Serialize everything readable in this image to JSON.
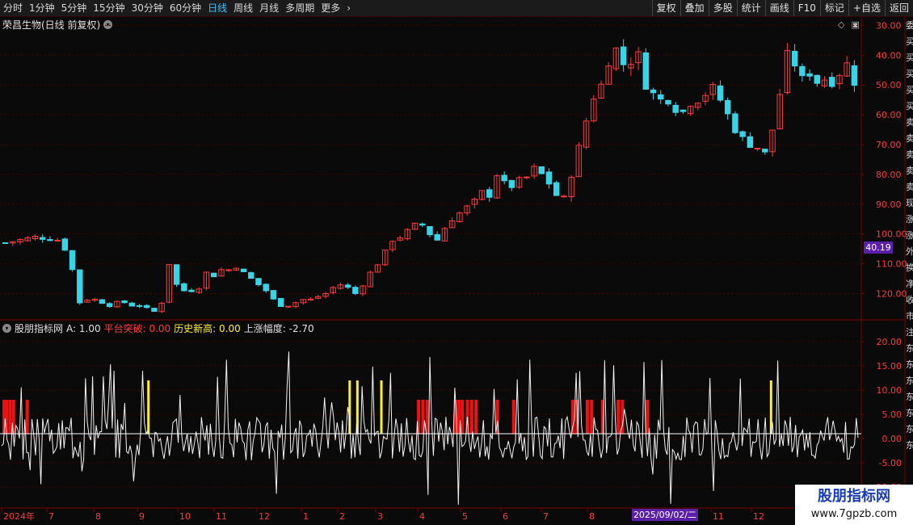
{
  "toolbar": {
    "periods": [
      "分时",
      "1分钟",
      "5分钟",
      "15分钟",
      "30分钟",
      "60分钟",
      "日线",
      "周线",
      "月线",
      "多周期",
      "更多"
    ],
    "active_period": "日线",
    "more_icon": "chevron-right-icon",
    "right_buttons": [
      "复权",
      "叠加",
      "多股",
      "统计",
      "画线",
      "F10",
      "标记",
      "+自选",
      "返回"
    ]
  },
  "stock": {
    "title": "荣昌生物(日线 前复权)",
    "menu_icon": "chevron-down-icon"
  },
  "top_icons": [
    "diamond-icon",
    "window-icon"
  ],
  "price_axis": {
    "ticks": [
      "120.00",
      "110.00",
      "100.00",
      "90.00",
      "80.00",
      "70.00",
      "60.00",
      "50.00",
      "40.00",
      "30.00"
    ],
    "current_price": "40.19"
  },
  "indicator": {
    "name": "股朋指标网",
    "series": [
      {
        "label": "A: 1.00",
        "color": "#e0e0e0"
      },
      {
        "label": "平台突破: 0.00",
        "color": "#ff3b3b"
      },
      {
        "label": "历史新高: 0.00",
        "color": "#ffee33"
      },
      {
        "label": "上涨幅度: -2.70",
        "color": "#e0e0e0"
      }
    ],
    "axis_ticks": [
      "20.00",
      "15.00",
      "10.00",
      "5.00",
      "0.00",
      "-5.00",
      "-10.00"
    ]
  },
  "date_axis": {
    "labels": [
      "2024年",
      "7",
      "8",
      "9",
      "10",
      "11",
      "12",
      "1",
      "2",
      "3",
      "4",
      "5",
      "6",
      "7",
      "8",
      "2025/09/02/二",
      "11",
      "12"
    ],
    "highlighted_date": "2025/09/02/二"
  },
  "side_glyphs": [
    "委",
    "买",
    "买",
    "买",
    "买",
    "买",
    "卖",
    "卖",
    "卖",
    "卖",
    "卖",
    "现",
    "涨",
    "涨",
    "外",
    "换",
    "净",
    "收",
    "市",
    "注",
    "东",
    "东",
    "东",
    "东",
    "东",
    "东",
    "东"
  ],
  "watermark": {
    "title": "股朋指标网",
    "url": "www.7gpzb.com"
  },
  "colors": {
    "up": "#ff3a3a",
    "down": "#3ad3e6",
    "grid": "#4a0000",
    "axis_text": "#ff3b3b",
    "accent": "#39c3ff",
    "tag": "#5b1fa8"
  },
  "chart_data": [
    {
      "type": "candlestick",
      "title": "荣昌生物(日线 前复权)",
      "ylim": [
        22,
        122
      ],
      "y_ticks": [
        30,
        40,
        50,
        60,
        70,
        80,
        90,
        100,
        110,
        120
      ],
      "current_price": 40.19,
      "close_path": [
        [
          0,
          47
        ],
        [
          4,
          49
        ],
        [
          7,
          48
        ],
        [
          8,
          45
        ],
        [
          9,
          38
        ],
        [
          10,
          27
        ],
        [
          11,
          28
        ],
        [
          12,
          28
        ],
        [
          13,
          27
        ],
        [
          14,
          26
        ],
        [
          15,
          27
        ],
        [
          16,
          27
        ],
        [
          17,
          26
        ],
        [
          18,
          26
        ],
        [
          19,
          25
        ],
        [
          20,
          24
        ],
        [
          21,
          27
        ],
        [
          22,
          40
        ],
        [
          23,
          33
        ],
        [
          24,
          31
        ],
        [
          25,
          31
        ],
        [
          26,
          32
        ],
        [
          27,
          37
        ],
        [
          28,
          36
        ],
        [
          29,
          38
        ],
        [
          30,
          38
        ],
        [
          31,
          39
        ],
        [
          32,
          37
        ],
        [
          33,
          35
        ],
        [
          34,
          33
        ],
        [
          35,
          31
        ],
        [
          36,
          28
        ],
        [
          37,
          26
        ],
        [
          38,
          26
        ],
        [
          39,
          27
        ],
        [
          40,
          28
        ],
        [
          41,
          28
        ],
        [
          42,
          29
        ],
        [
          43,
          30
        ],
        [
          44,
          32
        ],
        [
          45,
          33
        ],
        [
          46,
          32
        ],
        [
          47,
          30
        ],
        [
          48,
          33
        ],
        [
          49,
          37
        ],
        [
          50,
          40
        ],
        [
          51,
          44
        ],
        [
          52,
          48
        ],
        [
          53,
          49
        ],
        [
          54,
          51
        ],
        [
          55,
          53
        ],
        [
          56,
          53
        ],
        [
          57,
          50
        ],
        [
          58,
          48
        ],
        [
          59,
          52
        ],
        [
          60,
          55
        ],
        [
          61,
          57
        ],
        [
          62,
          59
        ],
        [
          63,
          61
        ],
        [
          64,
          64
        ],
        [
          65,
          63
        ],
        [
          66,
          70
        ],
        [
          67,
          67
        ],
        [
          68,
          66
        ],
        [
          69,
          68
        ],
        [
          70,
          69
        ],
        [
          71,
          72
        ],
        [
          72,
          70
        ],
        [
          73,
          67
        ],
        [
          74,
          63
        ],
        [
          75,
          62
        ],
        [
          76,
          70
        ],
        [
          77,
          79
        ],
        [
          78,
          88
        ],
        [
          79,
          96
        ],
        [
          80,
          100
        ],
        [
          81,
          108
        ],
        [
          82,
          112
        ],
        [
          83,
          107
        ],
        [
          84,
          108
        ],
        [
          85,
          110
        ],
        [
          86,
          100
        ],
        [
          87,
          97
        ],
        [
          88,
          95
        ],
        [
          89,
          95
        ],
        [
          90,
          92
        ],
        [
          91,
          91
        ],
        [
          92,
          94
        ],
        [
          93,
          95
        ],
        [
          94,
          97
        ],
        [
          95,
          99
        ],
        [
          96,
          95
        ],
        [
          97,
          90
        ],
        [
          98,
          85
        ],
        [
          99,
          82
        ],
        [
          100,
          80
        ],
        [
          101,
          79
        ],
        [
          102,
          77
        ],
        [
          103,
          85
        ],
        [
          104,
          97
        ],
        [
          105,
          110
        ],
        [
          106,
          107
        ],
        [
          107,
          102
        ],
        [
          108,
          104
        ],
        [
          109,
          101
        ],
        [
          110,
          102
        ],
        [
          111,
          101
        ],
        [
          112,
          104
        ],
        [
          113,
          107
        ],
        [
          114,
          101
        ]
      ],
      "n_bars": 115
    },
    {
      "type": "line",
      "title": "股朋指标网",
      "ylim": [
        -14,
        23
      ],
      "y_ticks": [
        20,
        15,
        10,
        5,
        0,
        -5,
        -10
      ],
      "series": [
        {
          "name": "A",
          "value": 1.0
        },
        {
          "name": "平台突破",
          "value": 0.0
        },
        {
          "name": "历史新高",
          "value": 0.0
        },
        {
          "name": "上涨幅度",
          "value": -2.7
        }
      ],
      "red_bar_positions": [
        0.001,
        0.004,
        0.008,
        0.012,
        0.028,
        0.485,
        0.49,
        0.495,
        0.528,
        0.532,
        0.536,
        0.542,
        0.547,
        0.552,
        0.577,
        0.596,
        0.665,
        0.67,
        0.682,
        0.687,
        0.7,
        0.718,
        0.723,
        0.752
      ],
      "yellow_bar_positions": [
        0.17,
        0.405,
        0.414,
        0.442,
        0.897
      ]
    }
  ]
}
